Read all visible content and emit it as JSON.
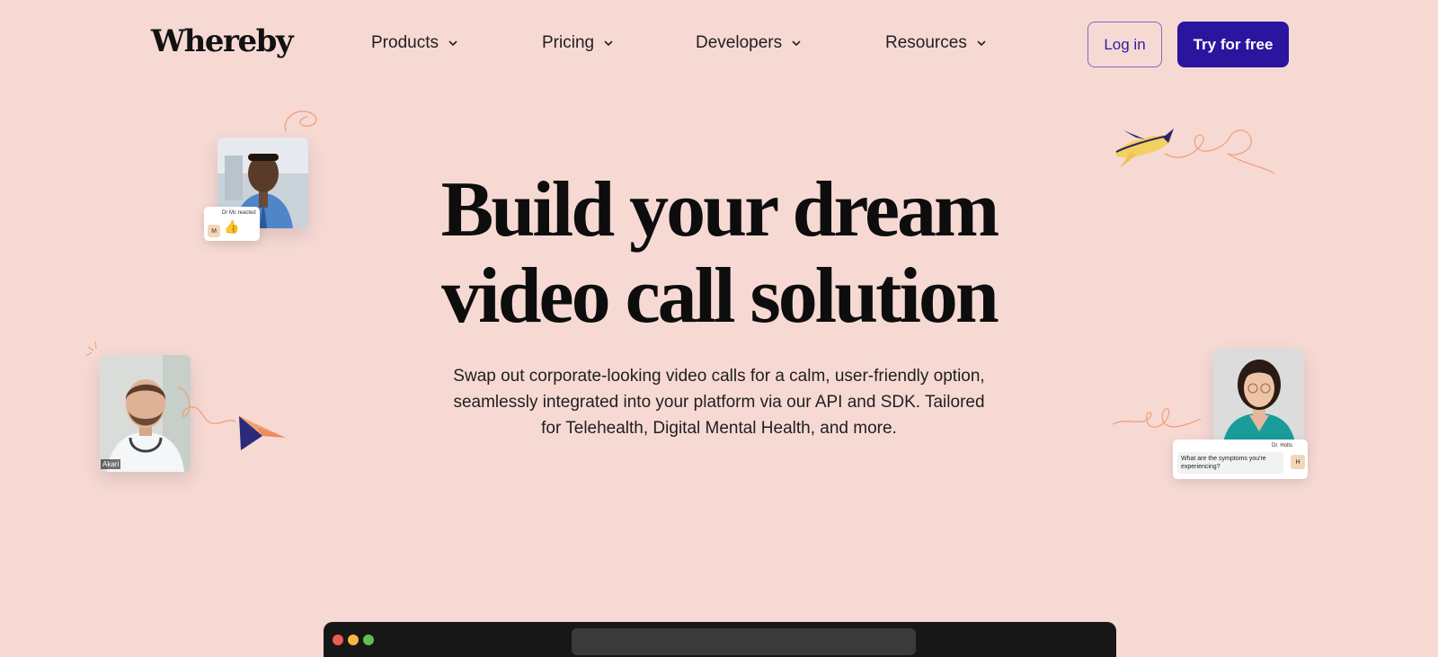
{
  "header": {
    "logo": "Whereby",
    "nav": [
      {
        "label": "Products"
      },
      {
        "label": "Pricing"
      },
      {
        "label": "Developers"
      },
      {
        "label": "Resources"
      }
    ],
    "login_label": "Log in",
    "cta_label": "Try for free"
  },
  "hero": {
    "title_line1": "Build your dream",
    "title_line2": "video call solution",
    "subtitle": "Swap out corporate-looking video calls for a calm, user-friendly option, seamlessly integrated into your platform via our API and SDK. Tailored for Telehealth, Digital Mental Health, and more."
  },
  "cards": {
    "top_left_caption": "Dr Mc reacted",
    "top_left_initial": "M",
    "top_left_reaction": "👍",
    "left_name": "Akari",
    "right_name": "Dr. Holts",
    "right_message": "What are the symptoms you're experiencing?",
    "right_initial": "H"
  },
  "colors": {
    "background": "#f7d9d4",
    "primary": "#2a159e",
    "browser": "#171717"
  }
}
